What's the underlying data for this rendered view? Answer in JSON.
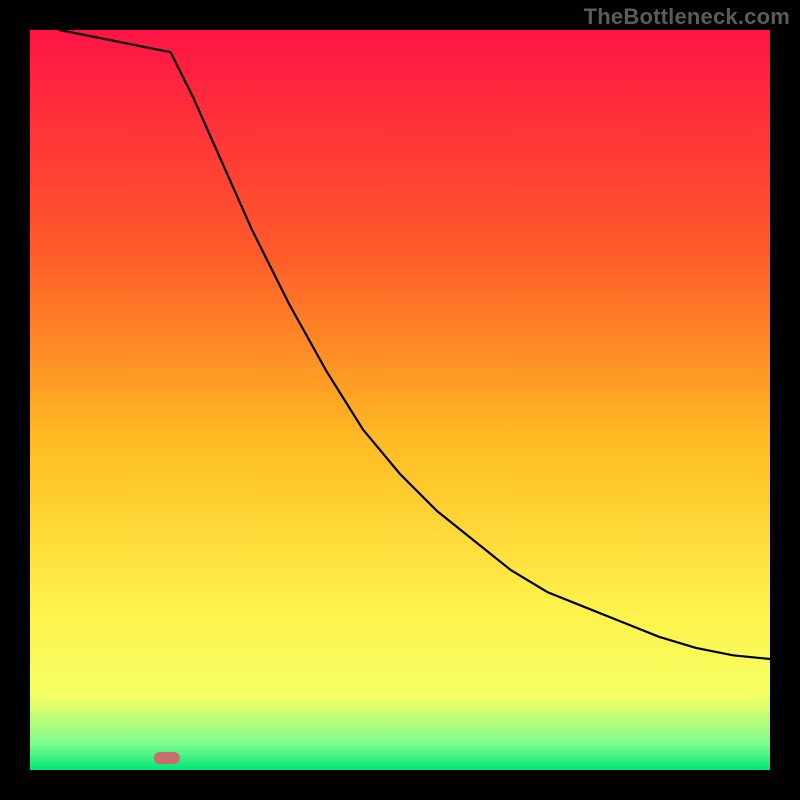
{
  "watermark": "TheBottleneck.com",
  "chart_data": {
    "type": "line",
    "title": "",
    "xlabel": "",
    "ylabel": "",
    "xlim": [
      0,
      100
    ],
    "ylim": [
      0,
      100
    ],
    "grid": false,
    "legend": false,
    "gradient_stops": [
      {
        "offset": 0.0,
        "color": "#ff1445"
      },
      {
        "offset": 0.3,
        "color": "#ff5a2a"
      },
      {
        "offset": 0.55,
        "color": "#ffb923"
      },
      {
        "offset": 0.78,
        "color": "#fff24a"
      },
      {
        "offset": 0.9,
        "color": "#f5ff64"
      },
      {
        "offset": 0.965,
        "color": "#7cfc8e"
      },
      {
        "offset": 1.0,
        "color": "#00e676"
      }
    ],
    "marker": {
      "x": 18.5,
      "y": 98.5,
      "color": "#c76f6f"
    },
    "series": [
      {
        "name": "left-branch",
        "x": [
          4,
          19
        ],
        "values": [
          100,
          97
        ]
      },
      {
        "name": "right-branch",
        "x": [
          19,
          22,
          26,
          30,
          35,
          40,
          45,
          50,
          55,
          60,
          65,
          70,
          75,
          80,
          85,
          90,
          95,
          100
        ],
        "values": [
          97,
          91,
          82,
          73,
          63,
          54,
          46,
          40,
          35,
          31,
          27,
          24,
          22,
          20,
          18,
          16.5,
          15.5,
          15
        ]
      }
    ],
    "annotations": []
  }
}
